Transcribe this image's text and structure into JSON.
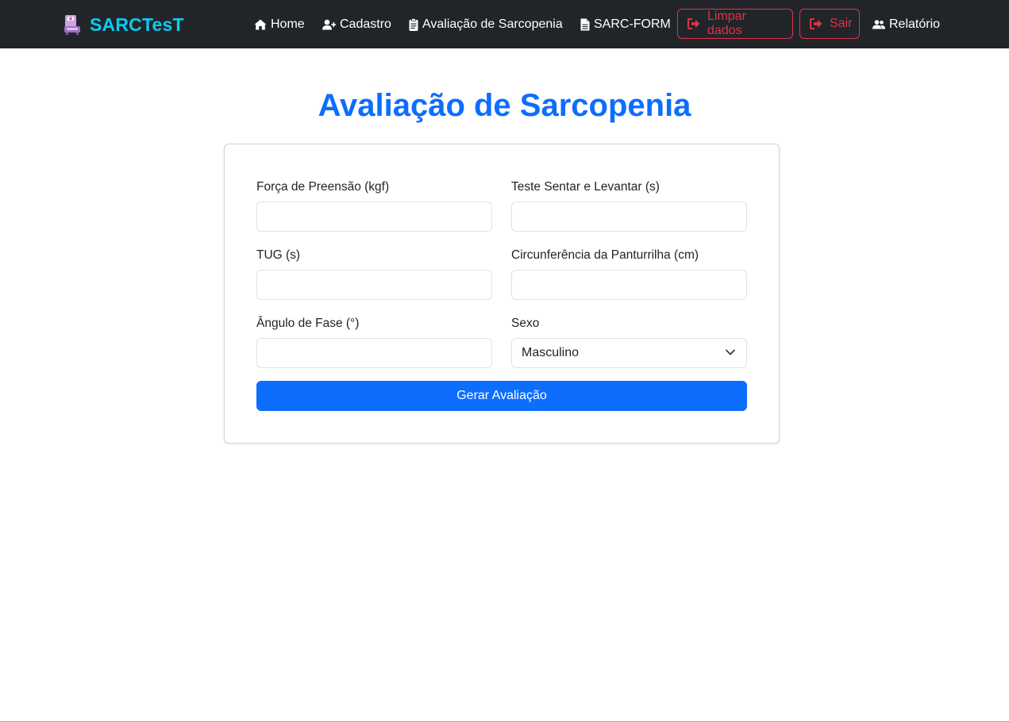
{
  "navbar": {
    "brand": "SARCTesT",
    "items": {
      "home": "Home",
      "cadastro": "Cadastro",
      "avaliacao": "Avaliação de Sarcopenia",
      "sarc_form": "SARC-FORM",
      "limpar": "Limpar dados",
      "sair": "Sair",
      "relatorio": "Relatório"
    }
  },
  "page": {
    "title": "Avaliação de Sarcopenia"
  },
  "form": {
    "forca_label": "Força de Preensão (kgf)",
    "forca_value": "",
    "sentar_label": "Teste Sentar e Levantar (s)",
    "sentar_value": "",
    "tug_label": "TUG (s)",
    "tug_value": "",
    "circ_label": "Circunferência da Panturrilha (cm)",
    "circ_value": "",
    "angulo_label": "Ângulo de Fase (°)",
    "angulo_value": "",
    "sexo_label": "Sexo",
    "sexo_value": "Masculino",
    "submit": "Gerar Avaliação"
  },
  "colors": {
    "navbar_bg": "#212529",
    "brand": "#0dcaf0",
    "primary": "#0d6efd",
    "danger": "#dc3545"
  }
}
